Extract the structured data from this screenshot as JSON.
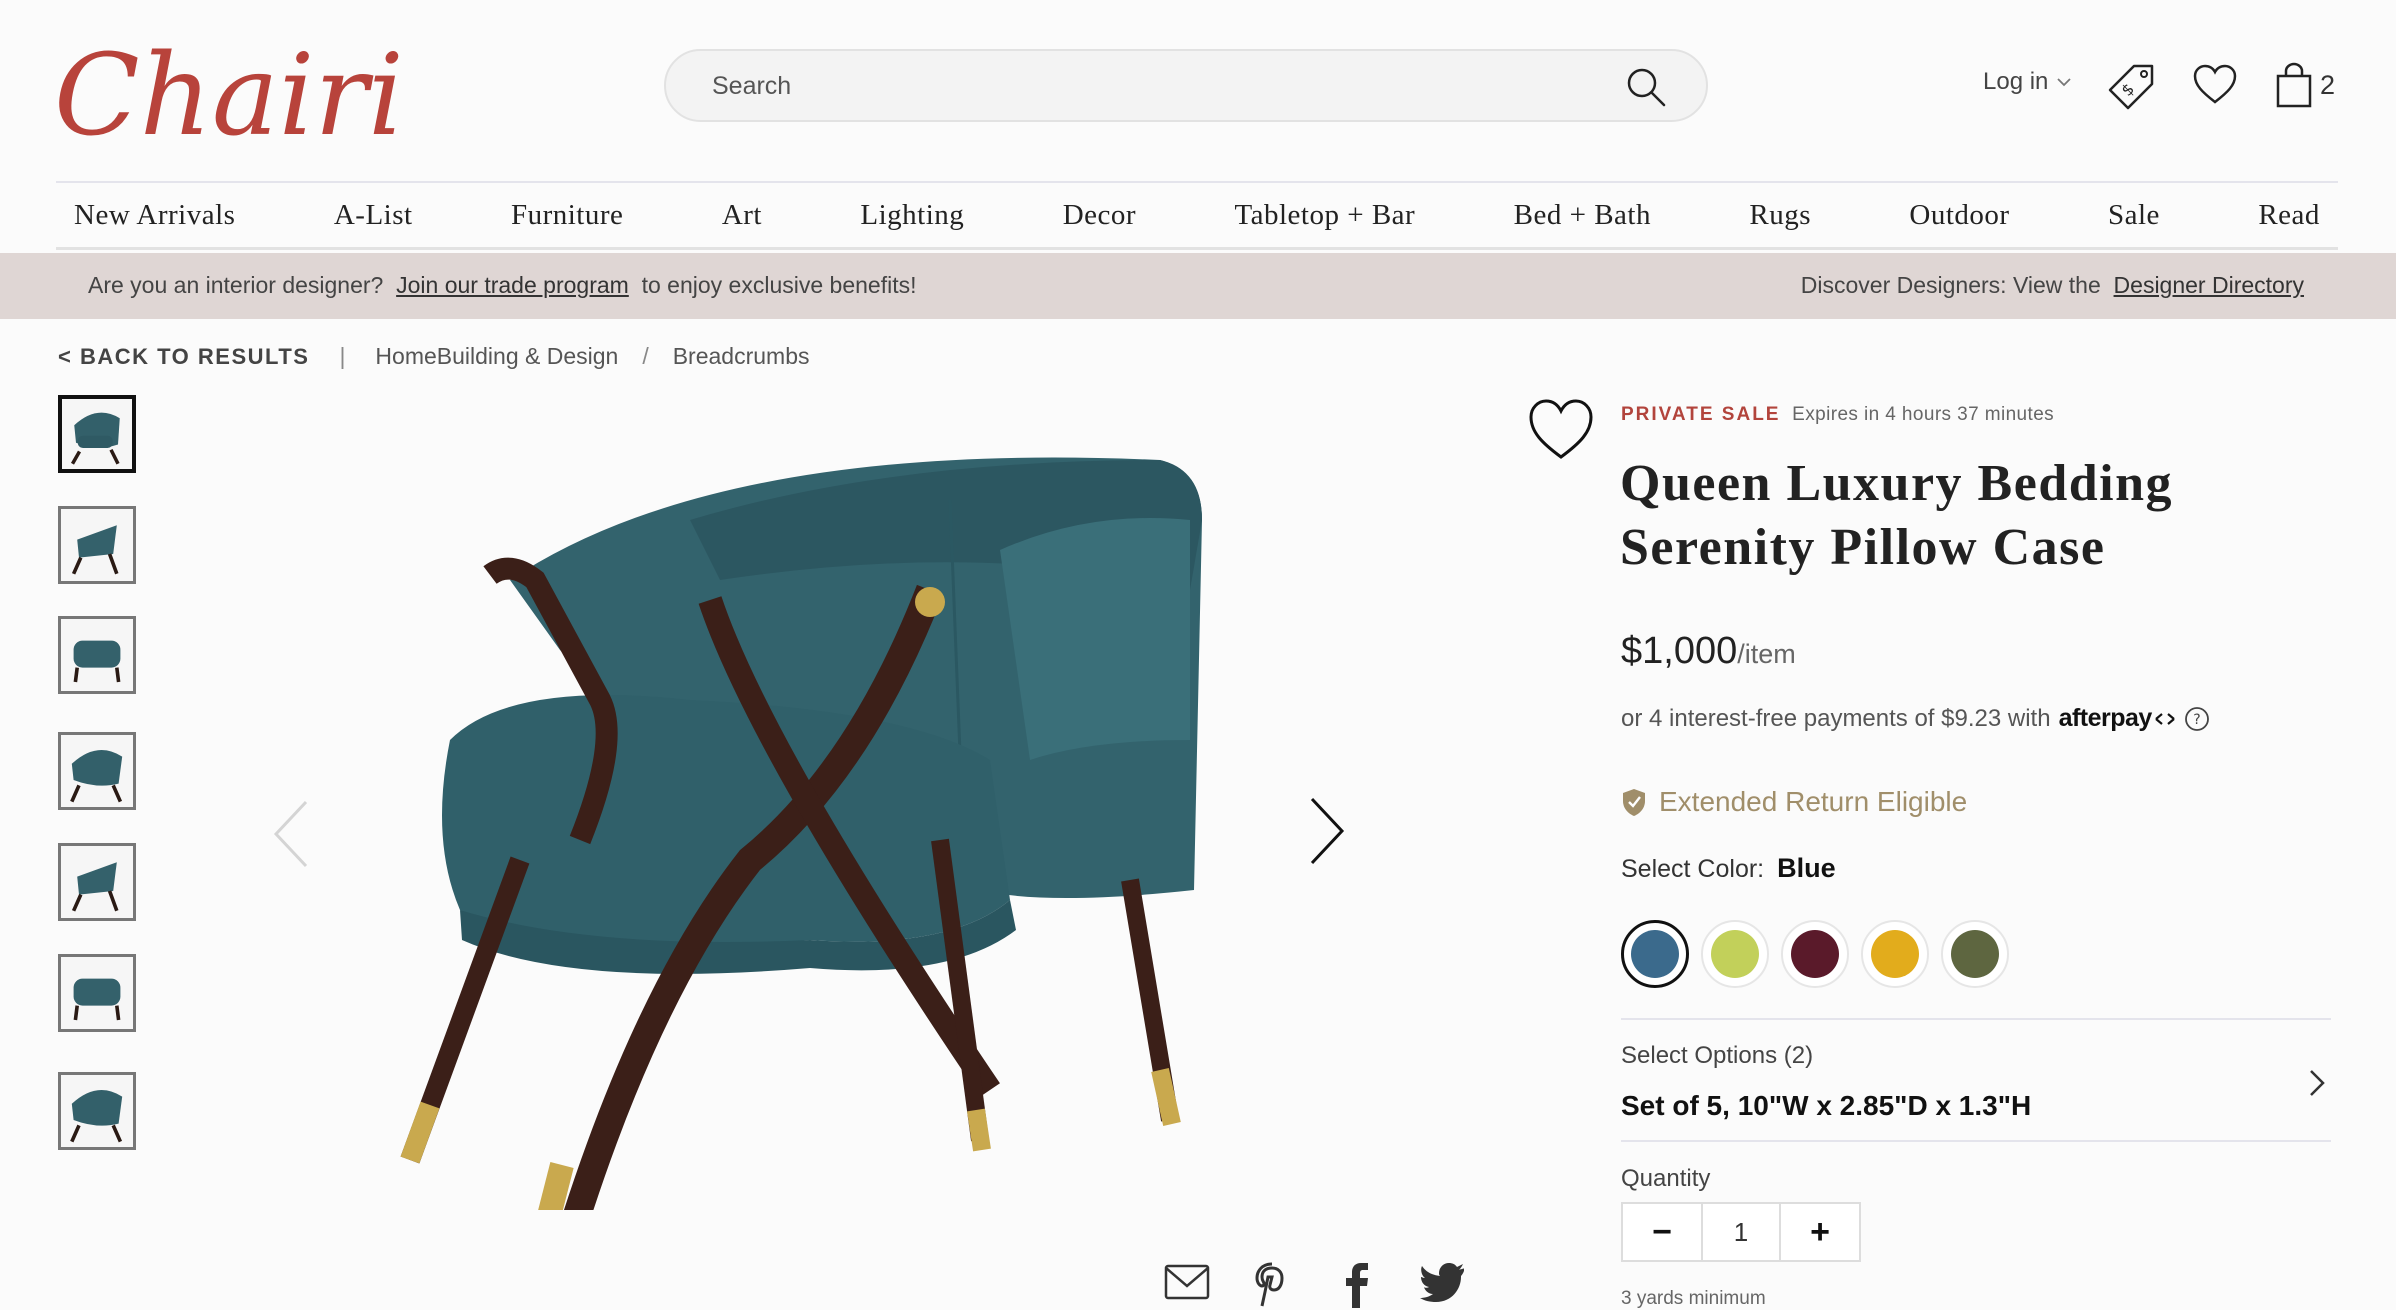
{
  "header": {
    "logo_text": "Chairish",
    "search_placeholder": "Search",
    "login_label": "Log in",
    "cart_count": "2"
  },
  "nav": {
    "items": [
      "New Arrivals",
      "A-List",
      "Furniture",
      "Art",
      "Lighting",
      "Decor",
      "Tabletop + Bar",
      "Bed + Bath",
      "Rugs",
      "Outdoor",
      "Sale",
      "Read"
    ]
  },
  "banner": {
    "left_prefix": "Are you an interior designer?",
    "left_link": "Join our trade program",
    "left_suffix": "to enjoy exclusive benefits!",
    "right_prefix": "Discover Designers: View the",
    "right_link": "Designer Directory"
  },
  "breadcrumbs": {
    "back": "< BACK TO RESULTS",
    "items": [
      "HomeBuilding & Design",
      "Breadcrumbs"
    ]
  },
  "product": {
    "private_sale": "PRIVATE SALE",
    "expires": "Expires in 4 hours 37 minutes",
    "title": "Queen Luxury Bedding Serenity Pillow Case",
    "price": "$1,000",
    "price_unit": "/item",
    "afterpay_text": "or 4 interest-free payments of $9.23 with",
    "afterpay_brand": "afterpay",
    "return_label": "Extended Return Eligible",
    "color_label": "Select Color:",
    "color_selected": "Blue",
    "colors": [
      "#3b6a8c",
      "#c2d05a",
      "#5a1a2a",
      "#e2ac1c",
      "#5e6640"
    ],
    "options_label": "Select Options (2)",
    "options_value": "Set of 5, 10\"W x 2.85\"D x 1.3\"H",
    "quantity_label": "Quantity",
    "quantity_value": "1",
    "minimum": "3 yards minimum"
  },
  "colors": {
    "brand_red": "#b2443c",
    "banner_bg": "#dfd6d4",
    "return_gold": "#a08e6a"
  }
}
